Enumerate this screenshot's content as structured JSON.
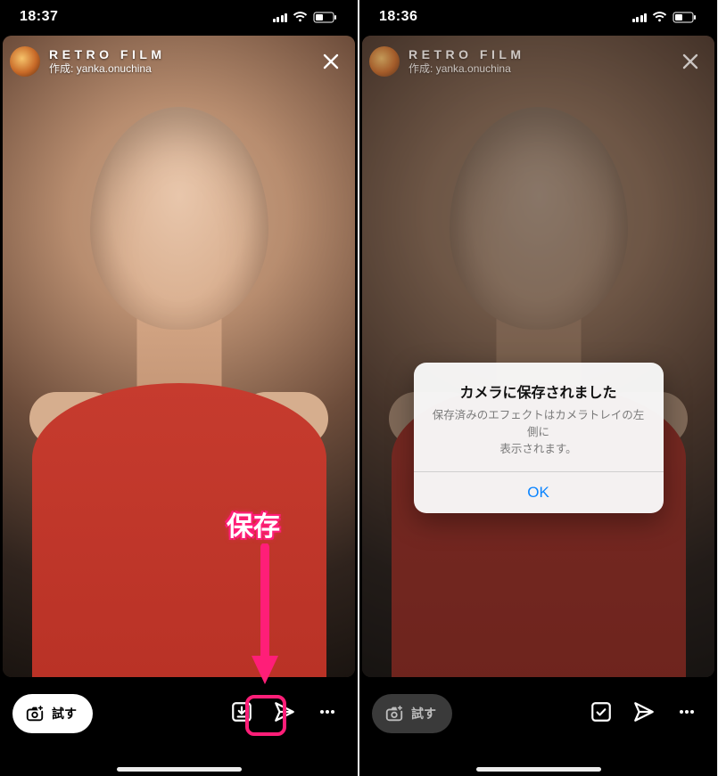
{
  "left": {
    "status_time": "18:37",
    "effect": {
      "name": "RETRO FILM",
      "author_prefix": "作成:",
      "author": "yanka.onuchina"
    },
    "try_label": "試す",
    "callout_save": "保存"
  },
  "right": {
    "status_time": "18:36",
    "effect": {
      "name": "RETRO FILM",
      "author_prefix": "作成:",
      "author": "yanka.onuchina"
    },
    "try_label": "試す",
    "modal": {
      "title": "カメラに保存されました",
      "message_line1": "保存済みのエフェクトはカメラトレイの左側に",
      "message_line2": "表示されます。",
      "ok": "OK"
    }
  },
  "icons": {
    "close": "close-icon",
    "save_effect": "save-to-camera-icon",
    "saved_check": "saved-check-icon",
    "share": "share-icon",
    "more": "more-icon",
    "camera_plus": "camera-plus-icon",
    "signal": "signal-icon",
    "wifi": "wifi-icon",
    "battery": "battery-icon"
  },
  "colors": {
    "highlight": "#ff1e78",
    "ios_blue": "#0a84ff"
  }
}
